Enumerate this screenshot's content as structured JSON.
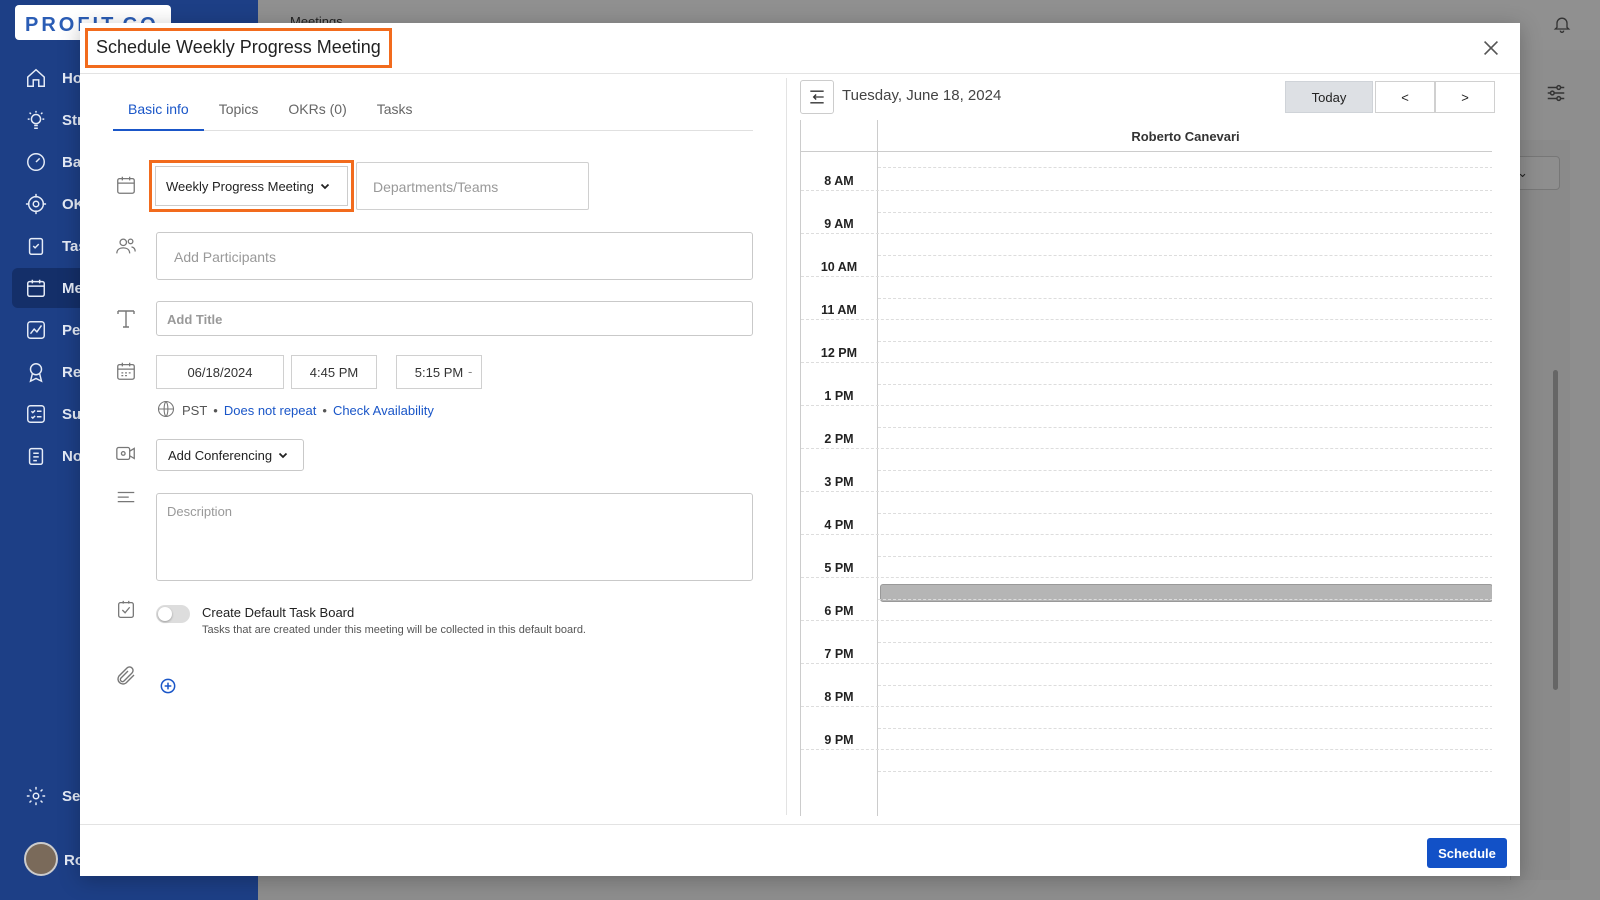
{
  "app": {
    "logo": "PROFIT.CO",
    "page_title": "Meetings",
    "sidebar": [
      {
        "label": "Ho",
        "icon": "home-icon"
      },
      {
        "label": "Str",
        "icon": "lightbulb-icon"
      },
      {
        "label": "Ba",
        "icon": "gauge-icon"
      },
      {
        "label": "OK",
        "icon": "target-icon"
      },
      {
        "label": "Tas",
        "icon": "clipboard-check-icon"
      },
      {
        "label": "Me",
        "icon": "calendar-icon",
        "active": true
      },
      {
        "label": "Pe",
        "icon": "chart-line-icon"
      },
      {
        "label": "Re",
        "icon": "award-icon"
      },
      {
        "label": "Su",
        "icon": "checklist-icon"
      },
      {
        "label": "No",
        "icon": "notes-icon"
      },
      {
        "label": "Se",
        "icon": "gear-icon"
      },
      {
        "label": "Ro",
        "icon": "avatar"
      }
    ],
    "select_partial": "k"
  },
  "modal": {
    "title": "Schedule Weekly Progress Meeting",
    "tabs": [
      "Basic info",
      "Topics",
      "OKRs (0)",
      "Tasks"
    ],
    "meeting_type": "Weekly Progress Meeting",
    "departments_placeholder": "Departments/Teams",
    "participants_placeholder": "Add Participants",
    "title_placeholder": "Add Title",
    "date": "06/18/2024",
    "start_time": "4:45 PM",
    "time_separator": "-",
    "end_time": "5:15 PM",
    "timezone": "PST",
    "bullet": "•",
    "repeat_link": "Does not repeat",
    "availability_link": "Check Availability",
    "conferencing": "Add Conferencing",
    "description_placeholder": "Description",
    "task_board_label": "Create Default Task Board",
    "task_board_sub": "Tasks that are created under this meeting will be collected in this default board.",
    "schedule_button": "Schedule"
  },
  "calendar": {
    "date_label": "Tuesday, June 18, 2024",
    "today": "Today",
    "prev": "<",
    "next": ">",
    "person": "Roberto Canevari",
    "hours": [
      "8 AM",
      "9 AM",
      "10 AM",
      "11 AM",
      "12 PM",
      "1 PM",
      "2 PM",
      "3 PM",
      "4 PM",
      "5 PM",
      "6 PM",
      "7 PM",
      "8 PM",
      "9 PM"
    ],
    "event": {
      "start": "4:45 PM",
      "end": "5:15 PM"
    }
  }
}
